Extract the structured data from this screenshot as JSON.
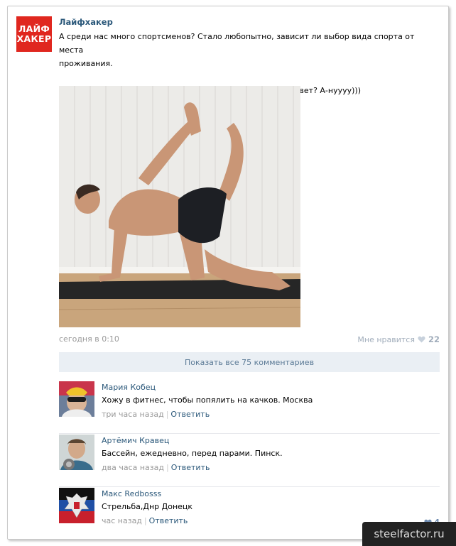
{
  "post": {
    "author": "Лайфхакер",
    "logo_line1": "ЛАЙФ",
    "logo_line2": "ХАКЕР",
    "text_line1": "А среди нас много спортсменов? Стало любопытно, зависит ли выбор вида спорта от места",
    "text_line2": "проживания.",
    "text_line3": "Кто каким видом спорта занимается и в каком городе живет? А-нуууу)))",
    "date": "сегодня в 0:10",
    "like_label": "Мне нравится",
    "like_count": "22",
    "show_comments": "Показать все 75 комментариев"
  },
  "comments": [
    {
      "name": "Мария Кобец",
      "text": "Хожу в фитнес, чтобы попялить на качков. Москва",
      "when": "три часа назад",
      "sep": "|",
      "reply": "Ответить"
    },
    {
      "name": "Артёмич Кравец",
      "text": "Бассейн, ежедневно, перед парами. Пинск.",
      "when": "два часа назад",
      "sep": "|",
      "reply": "Ответить"
    },
    {
      "name": "Макс Redbosss",
      "text": "Стрельба,Днр Донецк",
      "when": "час назад",
      "sep": "|",
      "reply": "Ответить",
      "likes": "4"
    }
  ],
  "watermark": "steelfactor.ru",
  "colors": {
    "brand_red": "#e0271f",
    "link_blue": "#2b587a",
    "muted": "#999999",
    "comments_bar": "#eaeff4"
  }
}
